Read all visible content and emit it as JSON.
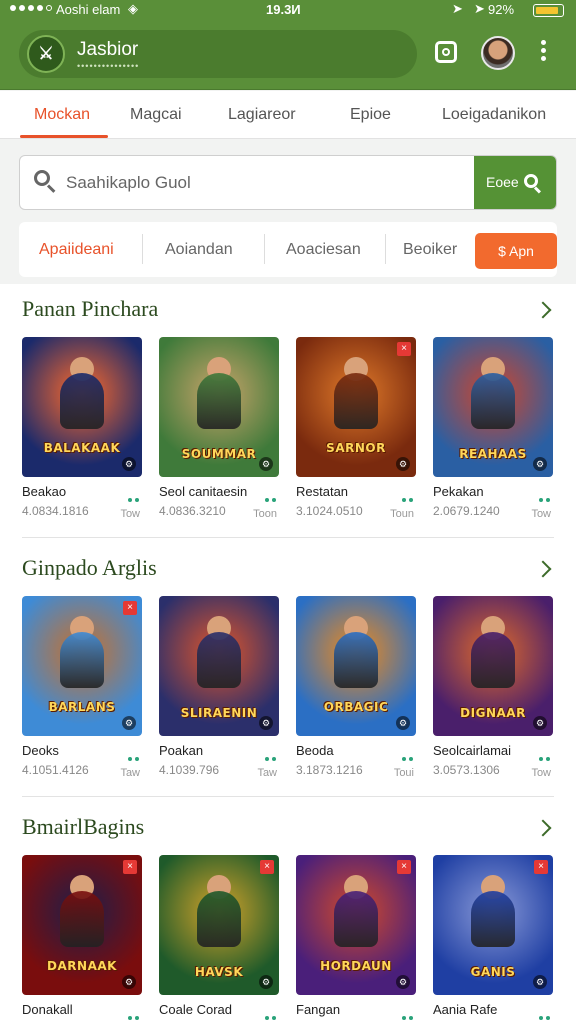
{
  "status": {
    "carrier": "Aoshi elam",
    "time": "19.3И",
    "battery": "92%"
  },
  "appbar": {
    "title": "Jasbior",
    "subtitle": "•••••••••••••••",
    "logo_icon": "swords-logo-icon"
  },
  "tabs": [
    "Mockan",
    "Magcai",
    "Lagiareor",
    "Epioe",
    "Loeigadanikon"
  ],
  "search": {
    "placeholder": "Saahikaplo Guol",
    "button_label": "Eoee"
  },
  "filters": {
    "chips": [
      "Apaiideani",
      "Aoiandan",
      "Aoaciesan",
      "Beoiker"
    ],
    "app_button": "$ Apn"
  },
  "sections": [
    {
      "title": "Panan Pinchara",
      "cards": [
        {
          "name": "Beakao",
          "meta": "4.0834.1816",
          "size": "Tow",
          "logo": "BALAKAAK",
          "bg": [
            "#1b2a6b",
            "#ff6a2a"
          ],
          "corner": false
        },
        {
          "name": "Seol canitaesin",
          "meta": "4.0836.3210",
          "size": "Toon",
          "logo": "SOUMMAR",
          "bg": [
            "#3f7a3a",
            "#c9a46a"
          ],
          "corner": false
        },
        {
          "name": "Restatan",
          "meta": "3.1024.0510",
          "size": "Toun",
          "logo": "SARNOR",
          "bg": [
            "#7a2a0e",
            "#e07a2a"
          ],
          "corner": true
        },
        {
          "name": "Pekakan",
          "meta": "2.0679.1240",
          "size": "Tow",
          "logo": "REAHAAS",
          "bg": [
            "#2a5fa3",
            "#d1452a"
          ],
          "corner": false
        }
      ]
    },
    {
      "title": "Ginpado Arglis",
      "cards": [
        {
          "name": "Deoks",
          "meta": "4.1051.4126",
          "size": "Taw",
          "logo": "BARLANS",
          "bg": [
            "#3e8bd6",
            "#c9702a"
          ],
          "corner": true
        },
        {
          "name": "Poakan",
          "meta": "4.1039.796",
          "size": "Taw",
          "logo": "SLIRAENIN",
          "bg": [
            "#2b2f6b",
            "#e0552a"
          ],
          "corner": false
        },
        {
          "name": "Beoda",
          "meta": "3.1873.1216",
          "size": "Toui",
          "logo": "ORBAGIC",
          "bg": [
            "#2b6fc4",
            "#f08a1a"
          ],
          "corner": false
        },
        {
          "name": "Seolcairlamai",
          "meta": "3.0573.1306",
          "size": "Tow",
          "logo": "DIGNAAR",
          "bg": [
            "#4a1f6b",
            "#e06a2a"
          ],
          "corner": false
        }
      ]
    },
    {
      "title": "BmairlBagins",
      "cards": [
        {
          "name": "Donakall",
          "meta": "",
          "size": "",
          "logo": "DARNAAK",
          "bg": [
            "#7a0d0d",
            "#1e1e4a"
          ],
          "corner": true
        },
        {
          "name": "Coale Corad",
          "meta": "",
          "size": "",
          "logo": "HAVSK",
          "bg": [
            "#1f5a2a",
            "#d4a32a"
          ],
          "corner": true
        },
        {
          "name": "Fangan",
          "meta": "",
          "size": "",
          "logo": "HORDAUN",
          "bg": [
            "#4a1f7a",
            "#d24a2a"
          ],
          "corner": true
        },
        {
          "name": "Aania Rafe",
          "meta": "",
          "size": "",
          "logo": "GANIS",
          "bg": [
            "#1f3fa3",
            "#8a9ad8"
          ],
          "corner": true
        }
      ]
    }
  ]
}
